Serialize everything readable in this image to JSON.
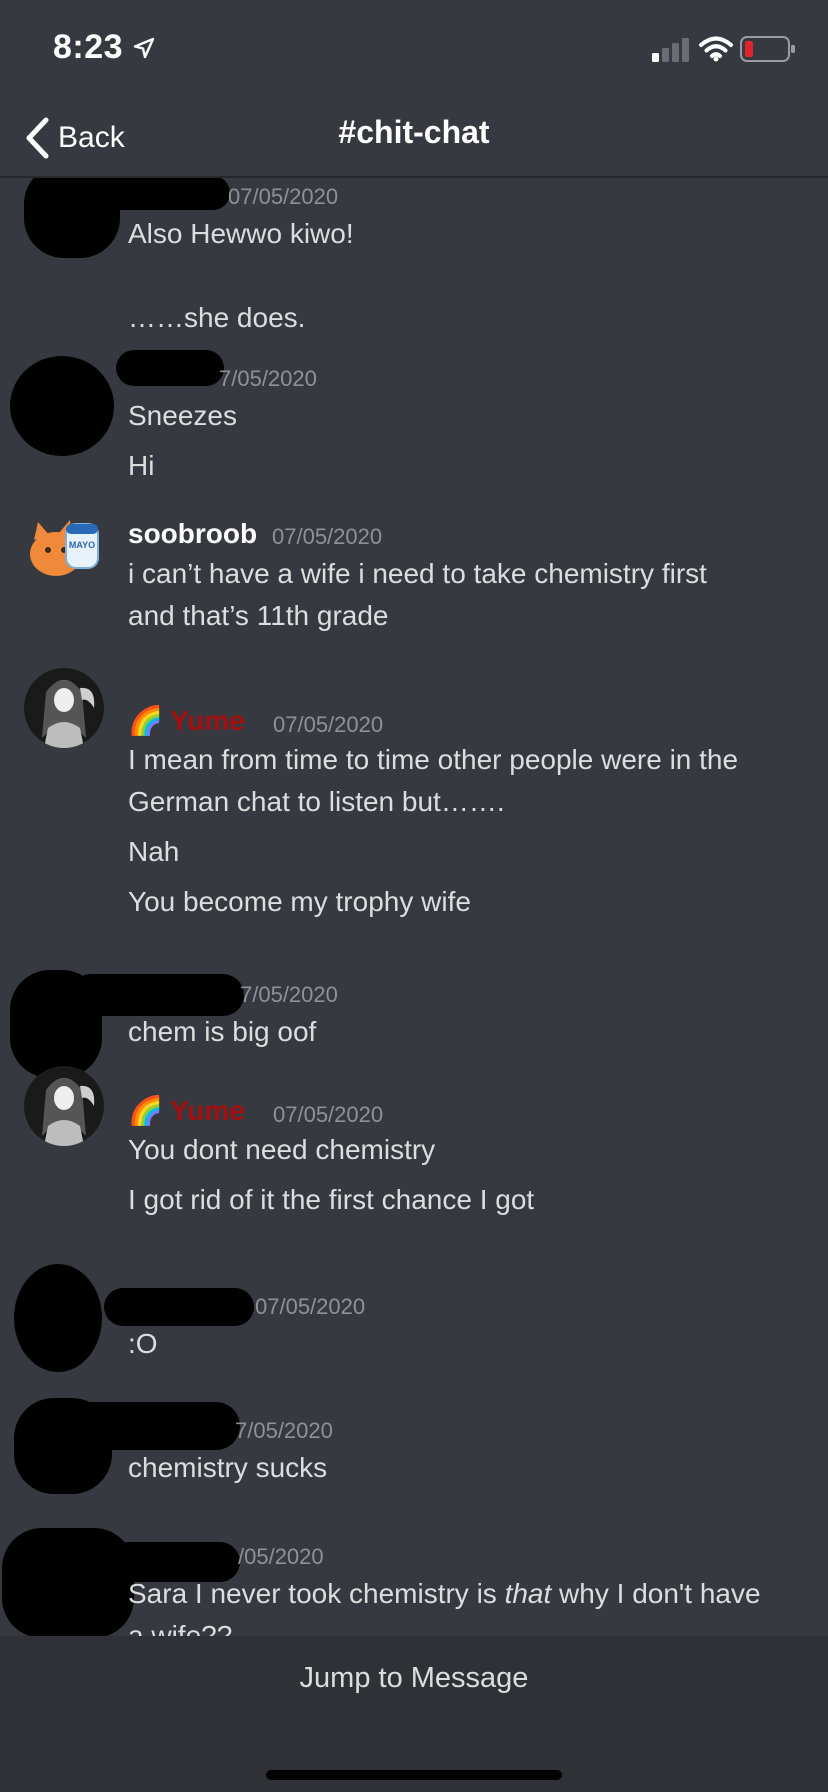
{
  "status_bar": {
    "time": "8:23",
    "icons": [
      "location-arrow-icon",
      "signal-icon",
      "wifi-icon",
      "battery-low-icon"
    ],
    "battery_color": "#e0242c"
  },
  "nav": {
    "back_label": "Back",
    "channel": "#chit-chat"
  },
  "messages": [
    {
      "author": "",
      "timestamp": "07/05/2020",
      "redacted": true,
      "lines": [
        "Also Hewwo kiwo!",
        "",
        "……she does."
      ]
    },
    {
      "author": "",
      "timestamp": "7/05/2020",
      "redacted": true,
      "lines": [
        "Sneezes",
        "Hi"
      ]
    },
    {
      "author": "soobroob",
      "author_color": "#ffffff",
      "timestamp": "07/05/2020",
      "lines": [
        "i can’t have a wife i need to take chemistry first",
        "and that’s 11th grade"
      ]
    },
    {
      "author": "Yume",
      "author_prefix": "🌈",
      "author_color": "#a50f0f",
      "timestamp": "07/05/2020",
      "lines": [
        "I mean from time to time other people were in the",
        "German chat to listen but…….",
        "Nah",
        "You become my trophy wife"
      ]
    },
    {
      "author": "",
      "timestamp": "7/05/2020",
      "redacted": true,
      "lines": [
        "chem is big oof"
      ]
    },
    {
      "author": "Yume",
      "author_prefix": "🌈",
      "author_color": "#a50f0f",
      "timestamp": "07/05/2020",
      "lines": [
        "You dont need chemistry",
        "I got rid of it the first chance I got"
      ]
    },
    {
      "author": "",
      "timestamp": "07/05/2020",
      "redacted": true,
      "lines": [
        ":O"
      ]
    },
    {
      "author": "",
      "timestamp": "7/05/2020",
      "redacted": true,
      "lines": [
        "chemistry sucks"
      ]
    },
    {
      "author": "",
      "timestamp": "/05/2020",
      "redacted": true,
      "lines": [
        "Sara I never took chemistry is ",
        "that",
        " why I don't have",
        "a wife??"
      ]
    }
  ],
  "footer": {
    "jump_label": "Jump to Message"
  },
  "colors": {
    "background": "#36393f",
    "footer_bg": "#2f3136",
    "timestamp": "#8e9297",
    "text": "#dcddde"
  }
}
